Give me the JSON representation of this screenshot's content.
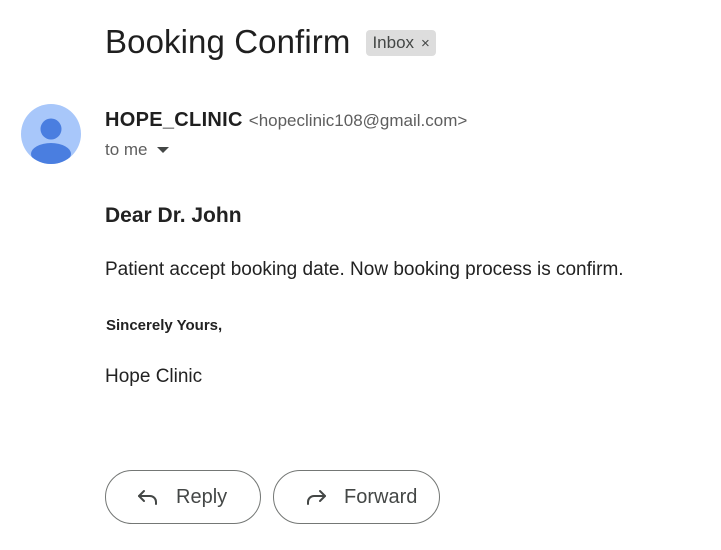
{
  "email": {
    "subject": "Booking Confirm",
    "label": "Inbox",
    "label_remove_glyph": "×",
    "sender_name": "HOPE_CLINIC",
    "sender_email": "<hopeclinic108@gmail.com>",
    "recipient_text": "to me",
    "greeting": "Dear Dr. John",
    "message": "Patient accept booking date. Now booking process is confirm.",
    "closing": "Sincerely Yours,",
    "signature": "Hope Clinic"
  },
  "actions": {
    "reply_label": "Reply",
    "forward_label": "Forward"
  },
  "icons": {
    "avatar": "default-avatar-icon",
    "recipients_toggle": "caret-down-icon",
    "reply": "reply-arrow-icon",
    "forward": "forward-arrow-icon"
  },
  "colors": {
    "avatar_bg": "#a8c7fa",
    "avatar_fg": "#4a7ee0",
    "chip_bg": "#dddddd"
  }
}
